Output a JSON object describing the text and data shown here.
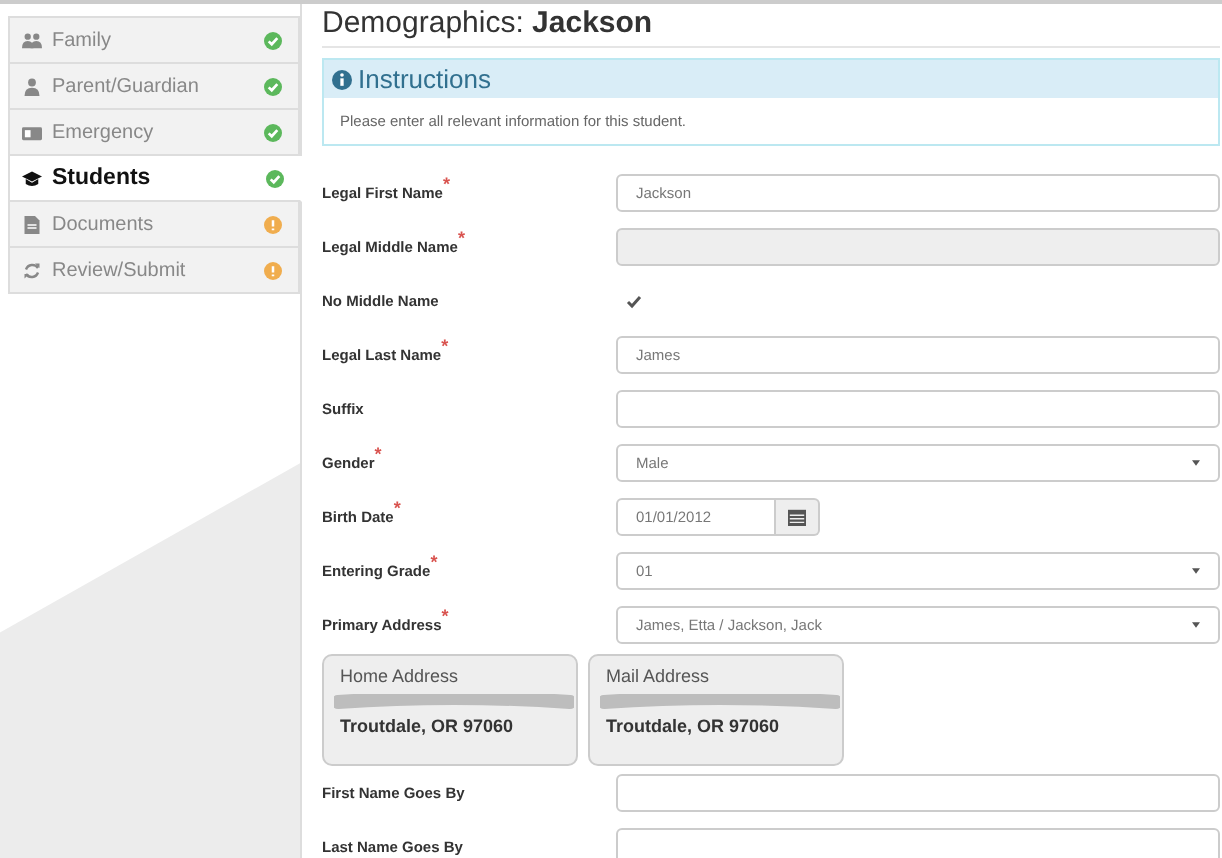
{
  "sidebar": {
    "items": [
      {
        "label": "Family",
        "selected": false,
        "kind": "complete"
      },
      {
        "label": "Parent/Guardian",
        "selected": false,
        "kind": "complete"
      },
      {
        "label": "Emergency",
        "selected": false,
        "kind": "complete"
      },
      {
        "label": "Students",
        "selected": true,
        "kind": "complete"
      },
      {
        "label": "Documents",
        "selected": false,
        "kind": "pending"
      },
      {
        "label": "Review/Submit",
        "selected": false,
        "kind": "pending"
      }
    ]
  },
  "title": "Demographics: **Jackson**",
  "instructions": {
    "heading": "Instructions",
    "text": "Please enter all relevant information for this student."
  },
  "fields": [
    {
      "kind": "text",
      "label": "Legal First Name",
      "required_mark": "*",
      "value": "Jackson"
    },
    {
      "kind": "disabled",
      "label": "Legal Middle Name",
      "required_mark": "*"
    },
    {
      "kind": "checkbox",
      "label": "No Middle Name",
      "checked": true
    },
    {
      "kind": "text",
      "label": "Legal Last Name",
      "required_mark": "*",
      "value": "James"
    },
    {
      "kind": "text",
      "label": "Suffix"
    },
    {
      "kind": "select",
      "label": "Gender",
      "required_mark": "*",
      "value": "Male"
    },
    {
      "kind": "date",
      "label": "Birth Date",
      "required_mark": "*",
      "value": "01/01/2012"
    },
    {
      "kind": "select",
      "label": "Entering Grade",
      "required_mark": "*",
      "value": "01"
    },
    {
      "kind": "select",
      "label": "Primary Address",
      "required_mark": "*",
      "value": "James, Etta / Jackson, Jack"
    },
    {
      "kind": "addresses",
      "cards": [
        {
          "heading": "Home Address",
          "city": "Troutdale, OR 97060"
        },
        {
          "heading": "Mail Address",
          "city": "Troutdale, OR 97060"
        }
      ]
    },
    {
      "kind": "text",
      "label": "First Name Goes By"
    },
    {
      "kind": "text",
      "label": "Last Name Goes By"
    }
  ]
}
